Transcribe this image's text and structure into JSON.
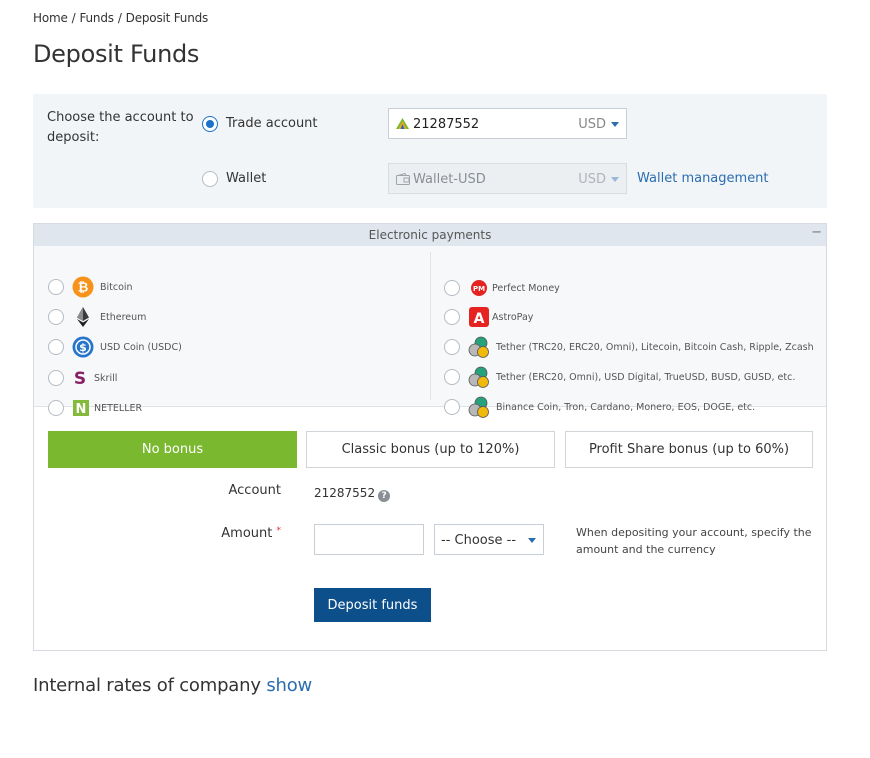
{
  "breadcrumb": {
    "home": "Home",
    "funds": "Funds",
    "current": "Deposit Funds",
    "separator": "/"
  },
  "page_title": "Deposit Funds",
  "account_choice": {
    "label": "Choose the account to deposit:",
    "trade": {
      "label": "Trade account",
      "checked": true,
      "account": "21287552",
      "currency": "USD"
    },
    "wallet": {
      "label": "Wallet",
      "checked": false,
      "account": "Wallet-USD",
      "currency": "USD",
      "disabled": true
    },
    "wallet_management": "Wallet management"
  },
  "payments": {
    "header": "Electronic payments",
    "collapse_symbol": "−",
    "left": [
      {
        "label": "Bitcoin",
        "icon": "bitcoin-icon"
      },
      {
        "label": "Ethereum",
        "icon": "ethereum-icon"
      },
      {
        "label": "USD Coin (USDC)",
        "icon": "usdc-icon"
      },
      {
        "label": "Skrill",
        "icon": "skrill-icon"
      },
      {
        "label": "NETELLER",
        "icon": "neteller-icon"
      }
    ],
    "right": [
      {
        "label": "Perfect Money",
        "icon": "perfect-money-icon"
      },
      {
        "label": "AstroPay",
        "icon": "astropay-icon"
      },
      {
        "label": "Tether (TRC20, ERC20, Omni), Litecoin, Bitcoin Cash, Ripple, Zcash",
        "icon": "crypto-coins-icon"
      },
      {
        "label": "Tether (ERC20, Omni), USD Digital, TrueUSD, BUSD, GUSD, etc.",
        "icon": "crypto-coins-icon"
      },
      {
        "label": "Binance Coin, Tron, Cardano, Monero, EOS, DOGE, etc.",
        "icon": "crypto-coins-icon"
      }
    ]
  },
  "bonus": {
    "options": [
      "No bonus",
      "Classic bonus (up to 120%)",
      "Profit Share bonus (up to 60%)"
    ],
    "selected": "No bonus"
  },
  "form": {
    "account_label": "Account",
    "account_value": "21287552",
    "help_symbol": "?",
    "amount_label": "Amount",
    "required_mark": "*",
    "amount_value": "",
    "currency_choose": "-- Choose --",
    "hint": "When depositing your account, specify the amount and the currency",
    "submit": "Deposit funds"
  },
  "rates": {
    "text": "Internal rates of company",
    "link": "show"
  },
  "colors": {
    "accent": "#1a73c8",
    "link": "#2a6db0",
    "bonus_active": "#7ab92f",
    "primary_button": "#0d4f8b"
  }
}
